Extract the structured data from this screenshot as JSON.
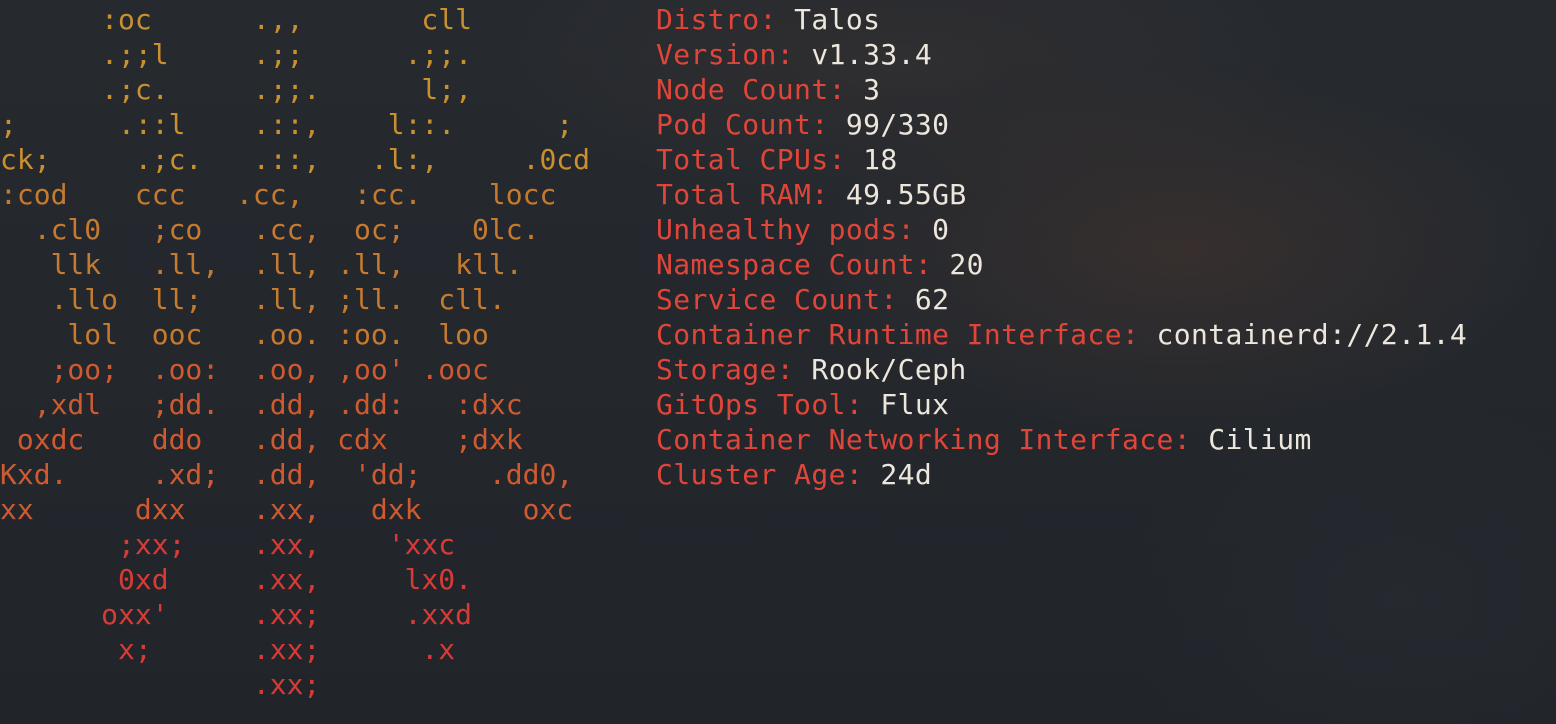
{
  "logo_art": {
    "lines": [
      "      :oc      .,,       cll",
      "      .;;l     .;;      .;;.",
      "      .;c.     .;;.      l;,",
      ";      .::l    .::,    l::.      ;",
      "ck;     .;c.   .::,   .l:,     .0cd",
      ":cod    ccc   .cc,   :cc.    locc",
      "  .cl0   ;co   .cc,  oc;    0lc.",
      "   llk   .ll,  .ll, .ll,   kll.",
      "   .llo  ll;   .ll, ;ll.  cll.",
      "    lol  ooc   .oo. :oo.  loo",
      "   ;oo;  .oo:  .oo, ,oo' .ooc",
      "  ,xdl   ;dd.  .dd, .dd:   :dxc",
      " oxdc    ddo   .dd, cdx    ;dxk",
      "Kxd.     .xd;  .dd,  'dd;    .dd0,",
      "xx      dxx    .xx,   dxk      oxc",
      "       ;xx;    .xx,    'xxc",
      "       0xd     .xx,     lx0.",
      "      oxx'     .xx;     .xxd",
      "       x;      .xx;      .x",
      "               .xx;"
    ]
  },
  "info": [
    {
      "key": "Distro:",
      "value": "Talos"
    },
    {
      "key": "Version:",
      "value": "v1.33.4"
    },
    {
      "key": "Node Count:",
      "value": "3"
    },
    {
      "key": "Pod Count:",
      "value": "99/330"
    },
    {
      "key": "Total CPUs:",
      "value": "18"
    },
    {
      "key": "Total RAM:",
      "value": "49.55GB"
    },
    {
      "key": "Unhealthy pods:",
      "value": "0"
    },
    {
      "key": "Namespace Count:",
      "value": "20"
    },
    {
      "key": "Service Count:",
      "value": "62"
    },
    {
      "key": "Container Runtime Interface:",
      "value": "containerd://2.1.4"
    },
    {
      "key": "Storage:",
      "value": "Rook/Ceph"
    },
    {
      "key": "GitOps Tool:",
      "value": "Flux"
    },
    {
      "key": "Container Networking Interface:",
      "value": "Cilium"
    },
    {
      "key": "Cluster Age:",
      "value": "24d"
    }
  ],
  "colors": {
    "key_red": "#e0453a",
    "value_text": "#ece6dc",
    "art_gradient": [
      "#c9902f",
      "#c67a2e",
      "#cf5a30",
      "#d83a36"
    ]
  }
}
